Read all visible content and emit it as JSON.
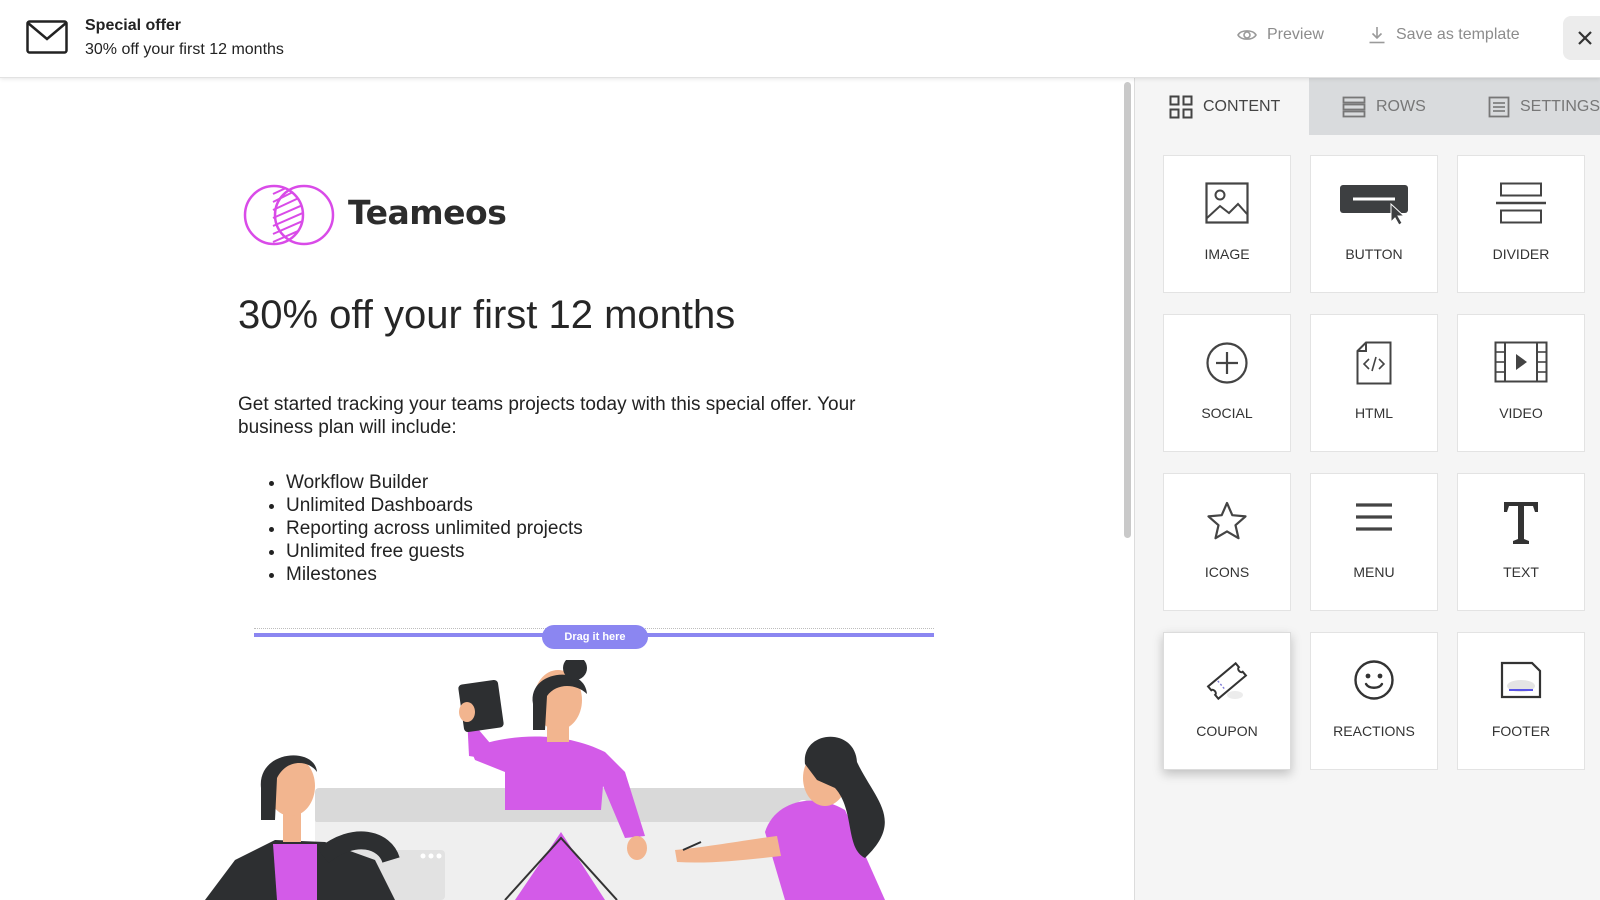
{
  "header": {
    "title": "Special offer",
    "subtitle": "30% off your first 12 months",
    "preview_label": "Preview",
    "save_template_label": "Save as template"
  },
  "email": {
    "brand_name": "Teameos",
    "headline": "30% off your first 12 months",
    "intro": "Get started tracking your teams projects today with this special offer. Your business plan will include:",
    "features": [
      "Workflow Builder",
      "Unlimited Dashboards",
      "Reporting across unlimited projects",
      "Unlimited free guests",
      "Milestones"
    ],
    "drop_hint": "Drag it here"
  },
  "panel": {
    "tabs": [
      {
        "label": "CONTENT",
        "icon": "grid-icon",
        "active": true
      },
      {
        "label": "ROWS",
        "icon": "rows-icon",
        "active": false
      },
      {
        "label": "SETTINGS",
        "icon": "settings-icon",
        "active": false
      }
    ],
    "blocks": [
      {
        "label": "IMAGE",
        "icon": "image-icon"
      },
      {
        "label": "BUTTON",
        "icon": "button-icon"
      },
      {
        "label": "DIVIDER",
        "icon": "divider-icon"
      },
      {
        "label": "SOCIAL",
        "icon": "plus-circle-icon"
      },
      {
        "label": "HTML",
        "icon": "code-file-icon"
      },
      {
        "label": "VIDEO",
        "icon": "video-icon"
      },
      {
        "label": "ICONS",
        "icon": "star-icon"
      },
      {
        "label": "MENU",
        "icon": "menu-icon"
      },
      {
        "label": "TEXT",
        "icon": "text-icon"
      },
      {
        "label": "COUPON",
        "icon": "ticket-icon"
      },
      {
        "label": "REACTIONS",
        "icon": "smiley-icon"
      },
      {
        "label": "FOOTER",
        "icon": "footer-icon"
      }
    ]
  },
  "colors": {
    "accent_purple": "#8b86f1",
    "brand_magenta": "#d94be8",
    "illustration_magenta": "#d35be8",
    "panel_bg": "#f5f5f5",
    "tab_inactive_bg": "#d9dbdd"
  }
}
